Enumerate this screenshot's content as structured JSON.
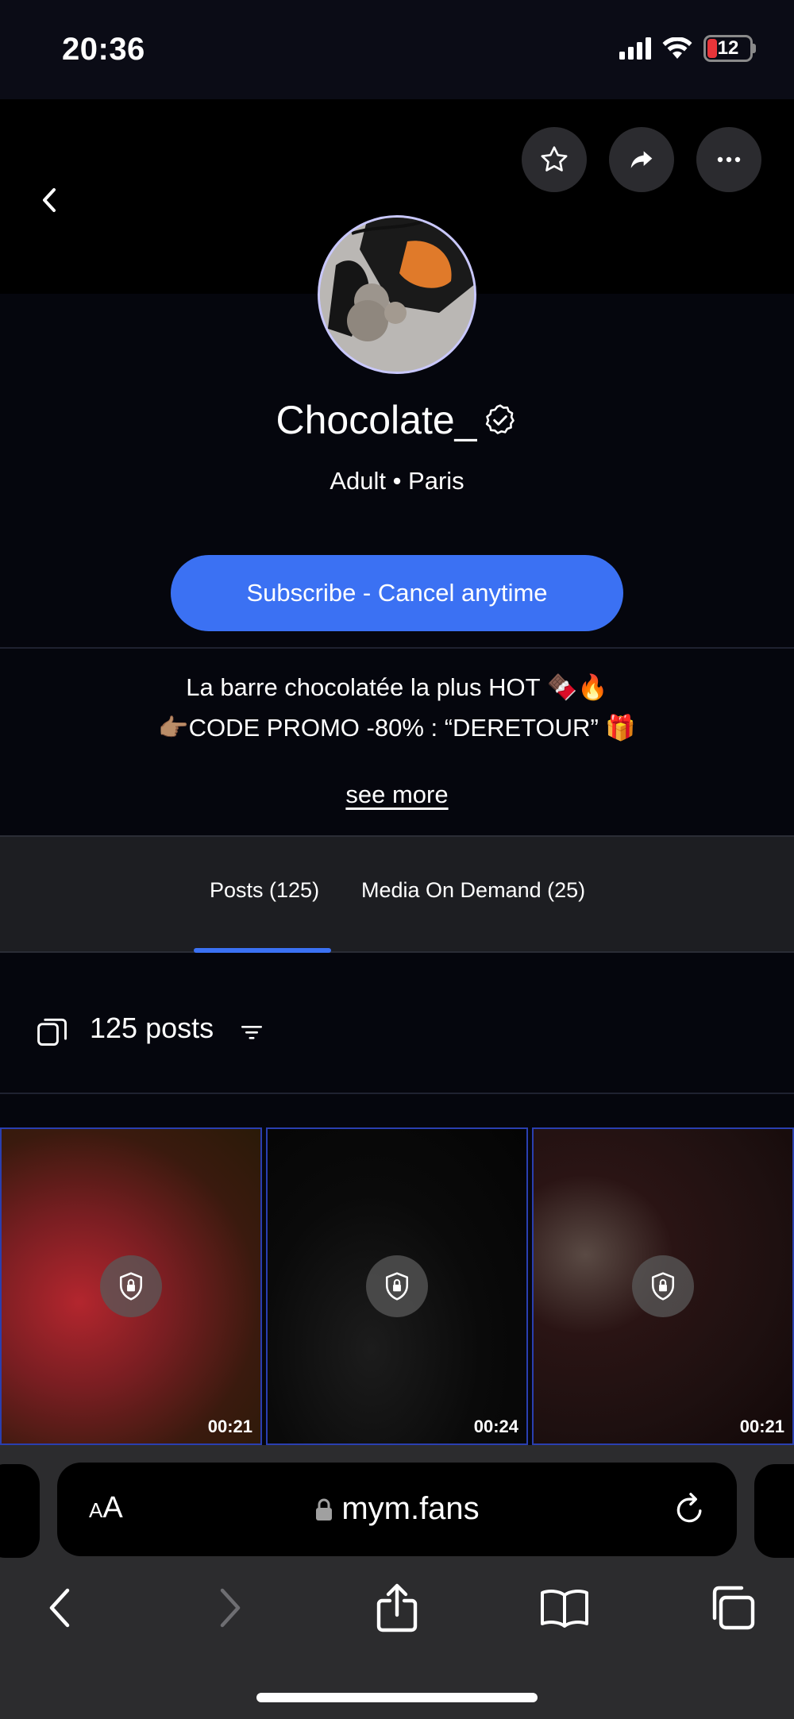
{
  "status_bar": {
    "time": "20:36",
    "battery": "12"
  },
  "profile": {
    "username": "Chocolate_",
    "meta": "Adult • Paris",
    "subscribe_label": "Subscribe - Cancel anytime",
    "bio_line1": "La barre chocolatée la plus HOT 🍫🔥",
    "bio_line2": "👉🏽CODE PROMO -80% : “DERETOUR” 🎁",
    "see_more": "see more"
  },
  "tabs": [
    {
      "label": "Posts (125)",
      "active": true
    },
    {
      "label": "Media On Demand (25)",
      "active": false
    }
  ],
  "posts": {
    "count_label": "125 posts",
    "items": [
      {
        "duration": "00:21",
        "locked": true,
        "color": "#7a1e22"
      },
      {
        "duration": "00:24",
        "locked": true,
        "color": "#0a0a0a"
      },
      {
        "duration": "00:21",
        "locked": true,
        "color": "#1e1010"
      }
    ]
  },
  "browser": {
    "url": "mym.fans",
    "text_size_label": "AA"
  },
  "colors": {
    "accent": "#3b71f3",
    "background": "#05060d",
    "battery_low": "#e8353a"
  },
  "icons": [
    "signal-icon",
    "wifi-icon",
    "battery-icon",
    "back-chevron-icon",
    "star-icon",
    "share-icon",
    "more-icon",
    "verified-icon",
    "stack-icon",
    "filter-icon",
    "lock-icon",
    "padlock-icon",
    "reload-icon",
    "share-up-icon",
    "bookmarks-icon",
    "tabs-icon"
  ]
}
